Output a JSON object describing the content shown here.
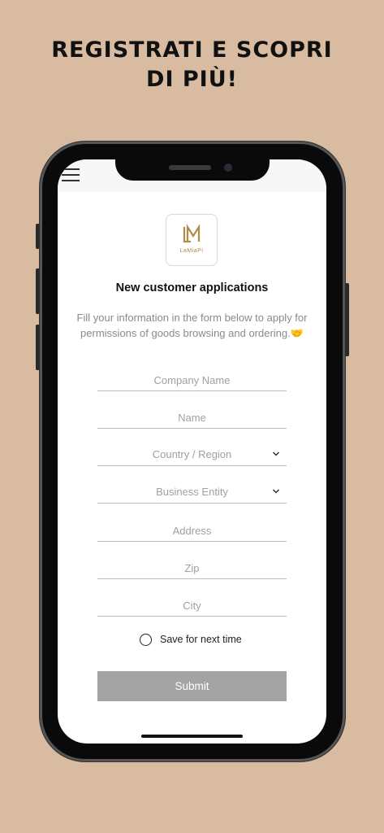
{
  "headline": {
    "line1": "REGISTRATI E SCOPRI",
    "line2": "DI PIÙ!"
  },
  "app": {
    "logo": {
      "monogram": "LM",
      "wordmark": "LaMiaPi",
      "color": "#b08a4a"
    },
    "menu_icon": "hamburger-icon",
    "title": "New customer applications",
    "description": "Fill your information in the form below to apply for permissions of goods browsing and ordering.🤝",
    "fields": {
      "company": {
        "placeholder": "Company Name",
        "value": ""
      },
      "name": {
        "placeholder": "Name",
        "value": ""
      },
      "country": {
        "placeholder": "Country / Region",
        "value": ""
      },
      "business_entity": {
        "placeholder": "Business Entity",
        "value": ""
      },
      "address": {
        "placeholder": "Address",
        "value": ""
      },
      "zip": {
        "placeholder": "Zip",
        "value": ""
      },
      "city": {
        "placeholder": "City",
        "value": ""
      }
    },
    "save_label": "Save for next time",
    "submit_label": "Submit"
  },
  "colors": {
    "background": "#d9bba2",
    "submit": "#a3a3a3",
    "logo_gold": "#b08a4a"
  }
}
